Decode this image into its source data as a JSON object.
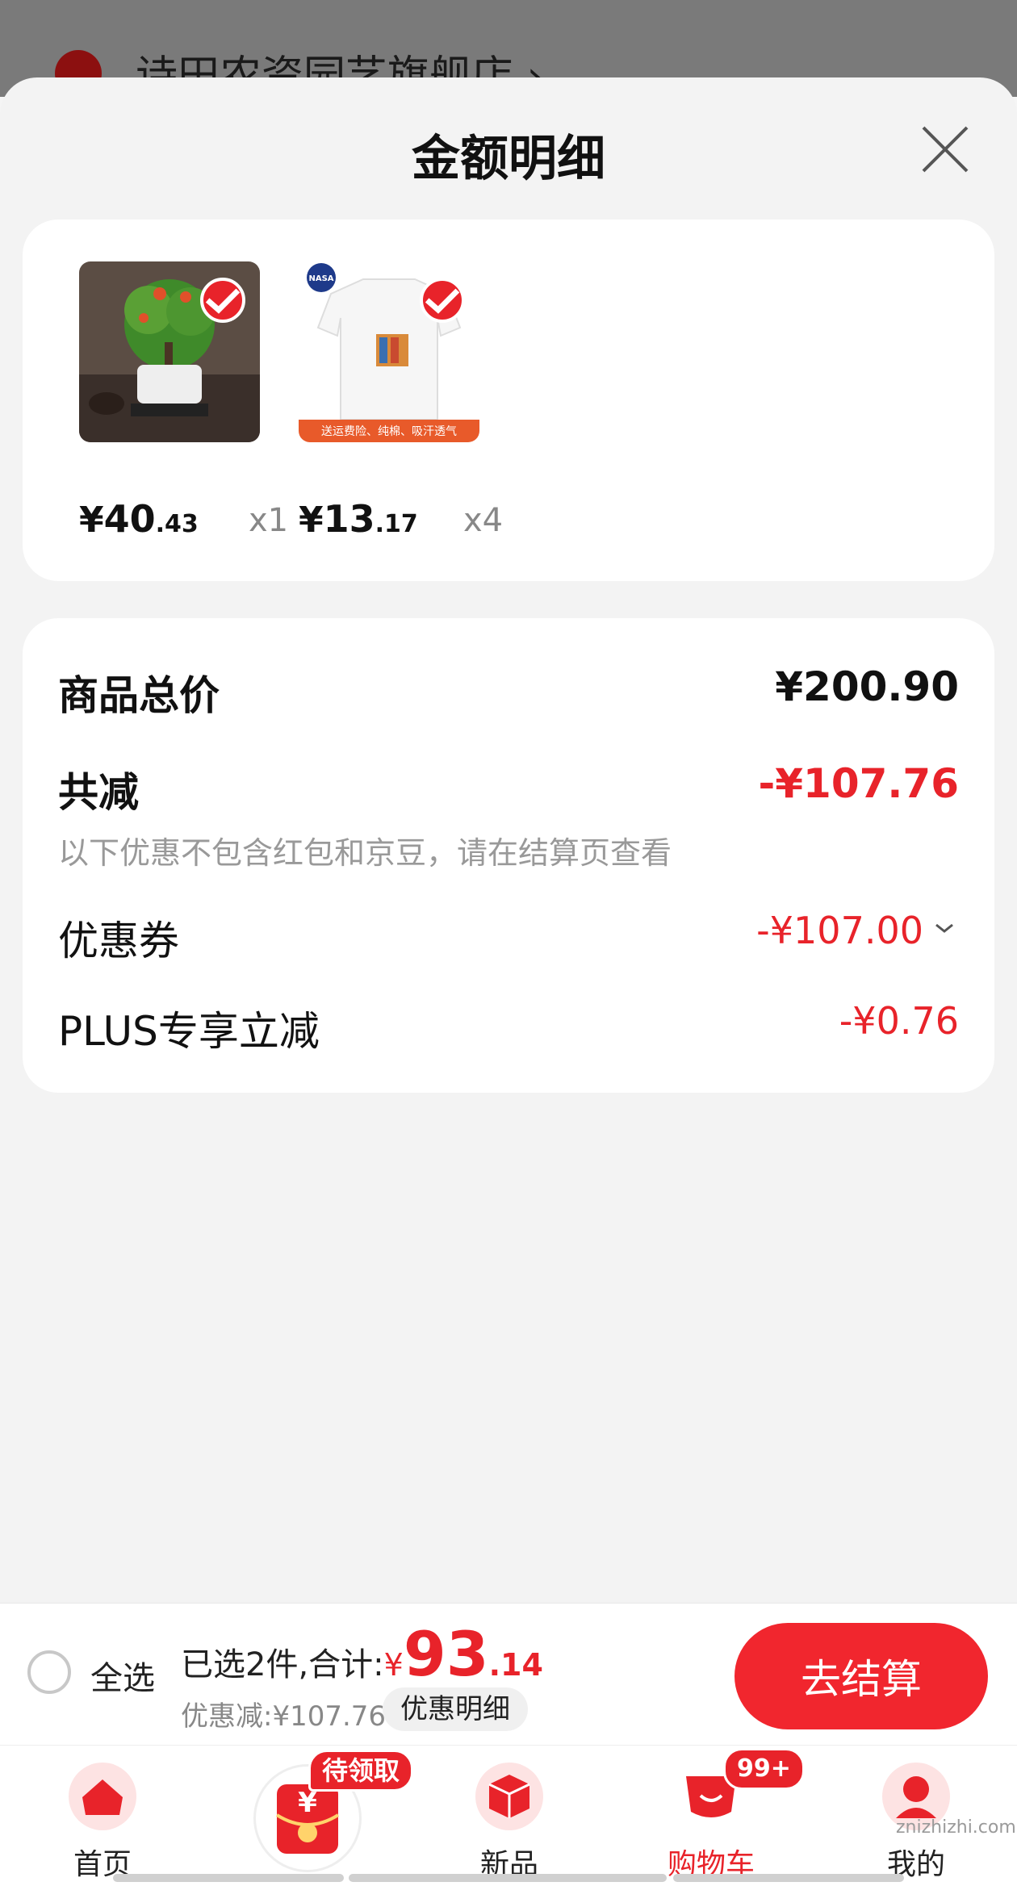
{
  "backdrop": {
    "store_name": "诗田农资园艺旗舰店 ›"
  },
  "sheet": {
    "title": "金额明细"
  },
  "items": [
    {
      "name": "bonsai",
      "price_currency": "¥",
      "price_int": "40",
      "price_dec": ".43",
      "qty": "x1"
    },
    {
      "name": "tshirt",
      "price_currency": "¥",
      "price_int": "13",
      "price_dec": ".17",
      "qty": "x4",
      "image_caption": "送运费险、纯棉、吸汗透气",
      "image_logo": "NASA"
    }
  ],
  "price_detail": {
    "total_label": "商品总价",
    "total_value": "¥200.90",
    "reduce_label": "共减",
    "reduce_value": "-¥107.76",
    "note": "以下优惠不包含红包和京豆，请在结算页查看",
    "coupon_label": "优惠券",
    "coupon_value": "-¥107.00",
    "plus_label": "PLUS专享立减",
    "plus_value": "-¥0.76"
  },
  "checkout": {
    "select_all": "全选",
    "summary_text": "已选2件,合计:",
    "total_currency": "¥",
    "total_int": "93",
    "total_dec": ".14",
    "discount_note": "优惠减:¥107.76",
    "detail_button": "优惠明细",
    "checkout_button": "去结算"
  },
  "tabbar": {
    "home": "首页",
    "coupon_badge": "待领取",
    "new": "新品",
    "cart": "购物车",
    "cart_badge": "99+",
    "mine": "我的"
  },
  "watermark": "znizhizhi.com",
  "colors": {
    "accent": "#e8232a",
    "button": "#f1262e",
    "muted": "#999999"
  }
}
